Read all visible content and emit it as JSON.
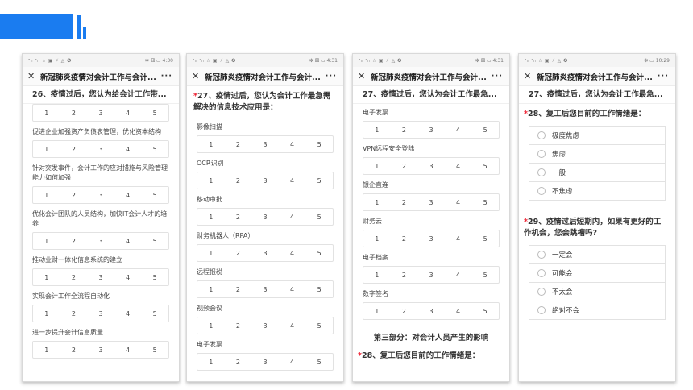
{
  "nav_title": "新冠肺炎疫情对会计工作与会计...",
  "more_glyph": "···",
  "close_glyph": "✕",
  "scale": [
    "1",
    "2",
    "3",
    "4",
    "5"
  ],
  "phones": [
    {
      "status_left": "ᵃᵢₗ ᵃᵢₗ ☆ ▣ ⚡ ◬ ✪",
      "status_right": "✻ ⚄ ▭ 4:30",
      "sticky": "26、疫情过后，您认为给会计工作带...",
      "items": [
        "促进企业加强资产负债表管理，优化资本结构",
        "针对突发事件，会计工作的应对措施与风险管理能力如何加强",
        "优化会计团队的人员结构，加快IT会计人才的培养",
        "推动业财一体化信息系统的建立",
        "实现会计工作全流程自动化",
        "进一步提升会计信息质量"
      ]
    },
    {
      "status_left": "ᵃᵢₗ ᵃᵢₗ ☆ ▣ ⚡ ◬ ✪",
      "status_right": "✻ ⚄ ▭ 4:31",
      "question": "27、疫情过后，您认为会计工作最急需解决的信息技术应用是：",
      "items": [
        "影像扫描",
        "OCR识别",
        "移动审批",
        "财务机器人（RPA）",
        "远程报税",
        "视频会议",
        "电子发票"
      ]
    },
    {
      "status_left": "ᵃᵢₗ ᵃᵢₗ ☆ ▣ ⚡ ◬ ✪",
      "status_right": "✻ ⚄ ▭ 4:31",
      "sticky": "27、疫情过后，您认为会计工作最急...",
      "items": [
        "电子发票",
        "VPN远程安全登陆",
        "银企直连",
        "财务云",
        "电子档案",
        "数字签名"
      ],
      "section": "第三部分：对会计人员产生的影响",
      "next_question": "28、复工后您目前的工作情绪是："
    },
    {
      "status_left": "ᵃᵢₗ ᵃᵢₗ ☆ ▣ ⚡ ◬ ✪",
      "status_right": "✻ ▭ 10:29",
      "sticky": "27、疫情过后，您认为会计工作最急...",
      "q28": "28、复工后您目前的工作情绪是：",
      "q28_options": [
        "极度焦虑",
        "焦虑",
        "一般",
        "不焦虑"
      ],
      "q29": "29、疫情过后短期内，如果有更好的工作机会，您会跳槽吗?",
      "q29_options": [
        "一定会",
        "可能会",
        "不太会",
        "绝对不会"
      ]
    }
  ]
}
